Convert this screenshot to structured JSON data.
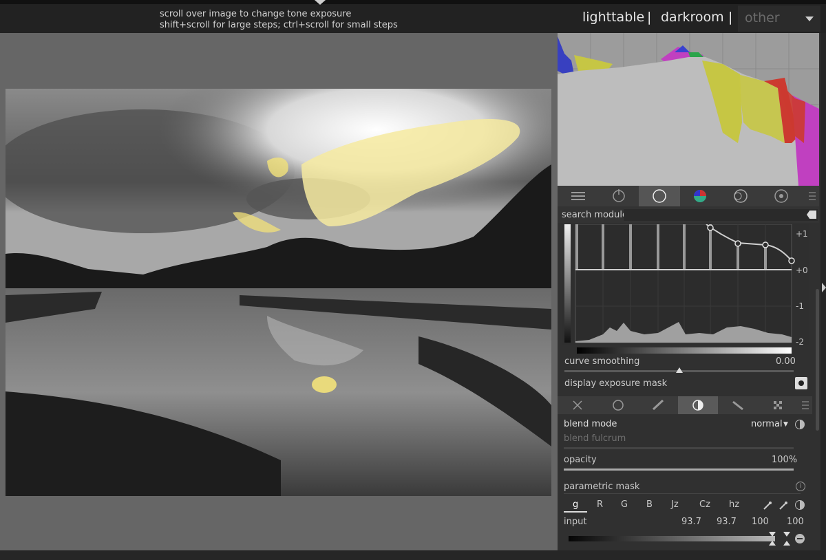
{
  "top": {
    "hint_line1": "scroll over image to change tone exposure",
    "hint_line2": "shift+scroll for large steps; ctrl+scroll for small steps",
    "view_lighttable": "lighttable",
    "sep1": "|",
    "view_darkroom": "darkroom",
    "sep2": "|",
    "view_other": "other"
  },
  "panel": {
    "search_label": "search module",
    "tabs": [
      "quick-access-icon",
      "power-icon",
      "circle-icon",
      "color-wheel-icon",
      "rotate-icon",
      "settings-flower-icon",
      "menu-icon"
    ]
  },
  "curve": {
    "ticks": [
      "+1",
      "+0",
      "-1",
      "-2"
    ],
    "smoothing_label": "curve smoothing",
    "smoothing_value": "0.00",
    "mask_label": "display exposure mask"
  },
  "blend": {
    "tabs": [
      "off-icon",
      "uniform-icon",
      "drawn-icon",
      "parametric-icon",
      "drawn-parametric-icon",
      "raster-icon",
      "menu-icon"
    ],
    "mode_label": "blend mode",
    "mode_value": "normal",
    "fulcrum_label": "blend fulcrum",
    "opacity_label": "opacity",
    "opacity_value": "100%",
    "param_mask_label": "parametric mask",
    "channels": [
      "g",
      "R",
      "G",
      "B",
      "Jz",
      "Cz",
      "hz"
    ],
    "input_label": "input",
    "input_values": [
      "93.7",
      "93.7",
      "100",
      "100"
    ]
  },
  "colors": {
    "accent": "#e0e0e0",
    "overexposed": "#f3e27a",
    "panel_bg": "#303030"
  }
}
